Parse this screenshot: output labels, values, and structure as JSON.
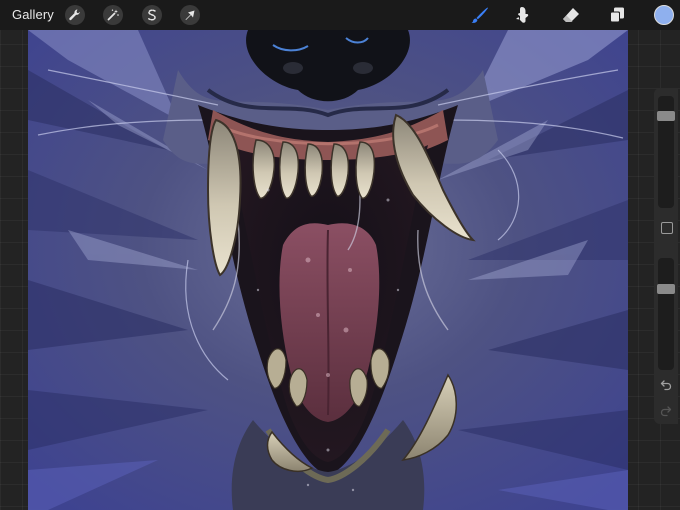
{
  "app": {
    "toolbar": {
      "gallery_label": "Gallery",
      "left_tools": [
        "wrench-icon",
        "magic-wand-icon",
        "selection-s-icon",
        "transform-arrow-icon"
      ],
      "right_tools": [
        "brush-icon",
        "smudge-icon",
        "eraser-icon",
        "layers-icon"
      ],
      "active_tool": "brush-icon",
      "current_color": "#8fb0ee"
    },
    "sidebar": {
      "brush_size_level": 0.15,
      "opacity_level": 0.25,
      "buttons": [
        "modify-square-icon",
        "undo-icon",
        "redo-icon"
      ]
    },
    "colors": {
      "accent": "#3a7ff6",
      "toolbar_bg": "#1a1a1a",
      "sidebar_bg": "#2c2c2c"
    }
  }
}
